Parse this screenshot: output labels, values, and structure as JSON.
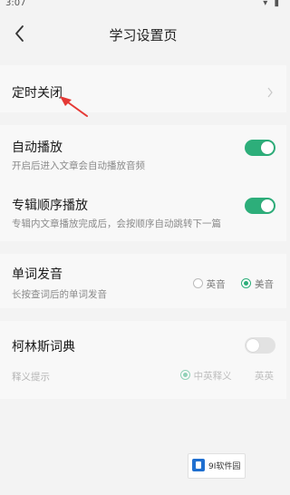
{
  "status_bar": {
    "time": "3:07",
    "icons": "▾ ▮"
  },
  "header": {
    "title": "学习设置页"
  },
  "settings": {
    "timer": {
      "label": "定时关闭"
    },
    "autoplay": {
      "label": "自动播放",
      "desc": "开启后进入文章会自动播放音频",
      "enabled": true
    },
    "album_sequence": {
      "label": "专辑顺序播放",
      "desc": "专辑内文章播放完成后，会按顺序自动跳转下一篇",
      "enabled": true
    },
    "word_pronunciation": {
      "label": "单词发音",
      "desc": "长按查词后的单词发音",
      "options": [
        "英音",
        "美音"
      ],
      "selected": "美音"
    },
    "collins": {
      "label": "柯林斯词典",
      "enabled": false,
      "sub_label": "释义提示",
      "options": [
        "中英释义",
        "英英"
      ],
      "selected": "中英释义"
    }
  },
  "watermark": {
    "text": "9I软件园"
  },
  "colors": {
    "accent": "#2dae7a",
    "annotation": "#e53935"
  }
}
